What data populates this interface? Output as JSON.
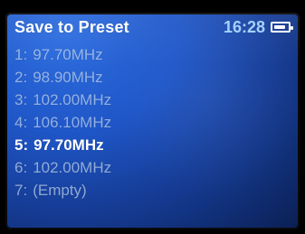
{
  "header": {
    "title": "Save to Preset",
    "time": "16:28"
  },
  "list": {
    "items": [
      {
        "number": "1:",
        "value": "97.70MHz",
        "selected": false
      },
      {
        "number": "2:",
        "value": "98.90MHz",
        "selected": false
      },
      {
        "number": "3:",
        "value": "102.00MHz",
        "selected": false
      },
      {
        "number": "4:",
        "value": "106.10MHz",
        "selected": false
      },
      {
        "number": "5:",
        "value": "97.70MHz",
        "selected": true
      },
      {
        "number": "6:",
        "value": "102.00MHz",
        "selected": false
      },
      {
        "number": "7:",
        "value": "(Empty)",
        "selected": false
      }
    ]
  },
  "colors": {
    "screen_top": "#2f6fe0",
    "screen_bottom": "#0b1f52",
    "clock": "#9fd0ff",
    "selected_text": "#ffffff",
    "unselected_text": "#d2e6ff"
  },
  "icons": {
    "battery": "battery-icon"
  }
}
